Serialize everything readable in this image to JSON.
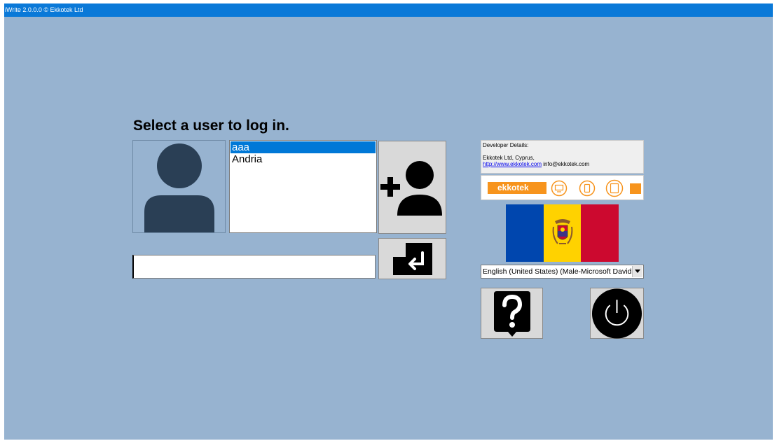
{
  "window": {
    "title": "iWrite 2.0.0.0 © Ekkotek Ltd"
  },
  "login": {
    "heading": "Select a user to log in.",
    "users": [
      "aaa",
      "Andria"
    ],
    "selected_user": "aaa",
    "password_value": ""
  },
  "developer": {
    "label": "Developer Details:",
    "company": "Ekkotek Ltd, Cyprus,",
    "website": "http://www.ekkotek.com",
    "email": "info@ekkotek.com",
    "logo_text": "ekkotek"
  },
  "language": {
    "selected": "English (United States) (Male-Microsoft David"
  },
  "flag": {
    "colors": [
      "#0046ae",
      "#ffd200",
      "#cc092f"
    ]
  },
  "icons": {
    "avatar": "user-silhouette-icon",
    "add_user": "add-user-icon",
    "enter": "enter-return-icon",
    "help": "help-question-icon",
    "power": "power-icon",
    "device_icons": [
      "monitor-icon",
      "phone-icon",
      "tablet-icon"
    ]
  },
  "colors": {
    "background": "#97b3d0",
    "titlebar": "#0a79d8",
    "selection": "#0078d7",
    "avatar": "#2a3f55",
    "logo_orange": "#f7941d"
  }
}
